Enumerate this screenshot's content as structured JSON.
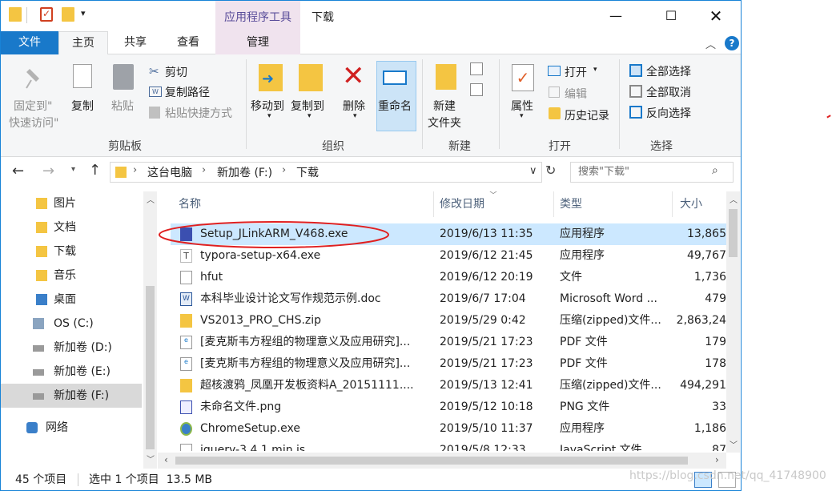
{
  "window": {
    "title": "下载",
    "context_tab_header": "应用程序工具"
  },
  "tabs": [
    "文件",
    "主页",
    "共享",
    "查看",
    "管理"
  ],
  "ribbon": {
    "pin": [
      "固定到\"",
      "快速访问\""
    ],
    "copy": "复制",
    "paste": "粘贴",
    "cut": "剪切",
    "copy_path": "复制路径",
    "paste_shortcut": "粘贴快捷方式",
    "clipboard_group": "剪贴板",
    "move_to": "移动到",
    "copy_to": "复制到",
    "delete": "删除",
    "rename": "重命名",
    "organize_group": "组织",
    "new_folder": [
      "新建",
      "文件夹"
    ],
    "new_group": "新建",
    "properties": "属性",
    "open": "打开",
    "edit": "编辑",
    "history": "历史记录",
    "open_group": "打开",
    "select_all": "全部选择",
    "select_none": "全部取消",
    "invert_selection": "反向选择",
    "select_group": "选择"
  },
  "address": {
    "crumbs": [
      "这台电脑",
      "新加卷 (F:)",
      "下载"
    ],
    "search_placeholder": "搜索\"下载\""
  },
  "nav_items": [
    {
      "label": "图片",
      "icon": "pictures-folder-icon"
    },
    {
      "label": "文档",
      "icon": "documents-folder-icon"
    },
    {
      "label": "下载",
      "icon": "downloads-folder-icon"
    },
    {
      "label": "音乐",
      "icon": "music-folder-icon"
    },
    {
      "label": "桌面",
      "icon": "desktop-folder-icon"
    },
    {
      "label": "OS (C:)",
      "icon": "windows-drive-icon"
    },
    {
      "label": "新加卷 (D:)",
      "icon": "drive-icon"
    },
    {
      "label": "新加卷 (E:)",
      "icon": "drive-icon"
    },
    {
      "label": "新加卷 (F:)",
      "icon": "drive-icon"
    },
    {
      "label": "网络",
      "icon": "network-icon"
    }
  ],
  "columns": [
    "名称",
    "修改日期",
    "类型",
    "大小"
  ],
  "files": [
    {
      "name": "Setup_JLinkARM_V468.exe",
      "date": "2019/6/13 11:35",
      "type": "应用程序",
      "size": "13,865",
      "icon": "installer-icon",
      "selected": true
    },
    {
      "name": "typora-setup-x64.exe",
      "date": "2019/6/12 21:45",
      "type": "应用程序",
      "size": "49,767",
      "icon": "typora-icon"
    },
    {
      "name": "hfut",
      "date": "2019/6/12 20:19",
      "type": "文件",
      "size": "1,736",
      "icon": "file-icon"
    },
    {
      "name": "本科毕业设计论文写作规范示例.doc",
      "date": "2019/6/7 17:04",
      "type": "Microsoft Word ...",
      "size": "479",
      "icon": "word-doc-icon"
    },
    {
      "name": "VS2013_PRO_CHS.zip",
      "date": "2019/5/29 0:42",
      "type": "压缩(zipped)文件...",
      "size": "2,863,24",
      "icon": "zip-folder-icon"
    },
    {
      "name": "[麦克斯韦方程组的物理意义及应用研究]...",
      "date": "2019/5/21 17:23",
      "type": "PDF 文件",
      "size": "179",
      "icon": "pdf-icon"
    },
    {
      "name": "[麦克斯韦方程组的物理意义及应用研究]...",
      "date": "2019/5/21 17:23",
      "type": "PDF 文件",
      "size": "178",
      "icon": "pdf-icon"
    },
    {
      "name": "超核渡鸦_凤凰开发板资料A_20151111....",
      "date": "2019/5/13 12:41",
      "type": "压缩(zipped)文件...",
      "size": "494,291",
      "icon": "zip-folder-icon"
    },
    {
      "name": "未命名文件.png",
      "date": "2019/5/12 10:18",
      "type": "PNG 文件",
      "size": "33",
      "icon": "image-file-icon"
    },
    {
      "name": "ChromeSetup.exe",
      "date": "2019/5/10 11:37",
      "type": "应用程序",
      "size": "1,186",
      "icon": "chrome-setup-icon"
    },
    {
      "name": "jquery-3.4.1.min.js",
      "date": "2019/5/8 12:33",
      "type": "JavaScript 文件",
      "size": "87",
      "icon": "js-file-icon"
    }
  ],
  "status": {
    "count": "45 个项目",
    "selection": "选中 1 个项目  13.5 MB"
  },
  "watermark": "https://blog.csdn.net/qq_41748900",
  "colors": {
    "accent": "#1979ca",
    "selection": "#cce8ff",
    "annotation": "#e02020"
  }
}
